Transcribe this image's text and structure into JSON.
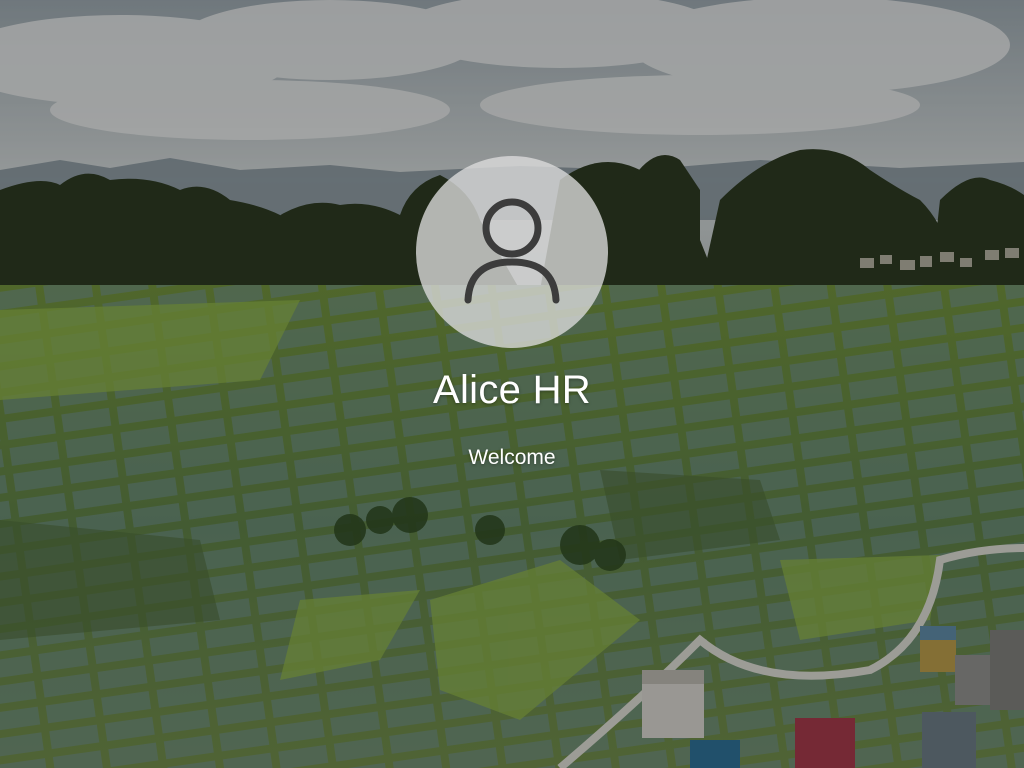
{
  "login": {
    "user_name": "Alice HR",
    "status_text": "Welcome",
    "avatar_icon": "user-icon"
  },
  "colors": {
    "text": "#ffffff",
    "avatar_bg": "#dcdcdc",
    "avatar_glyph": "#3c3c3c"
  }
}
